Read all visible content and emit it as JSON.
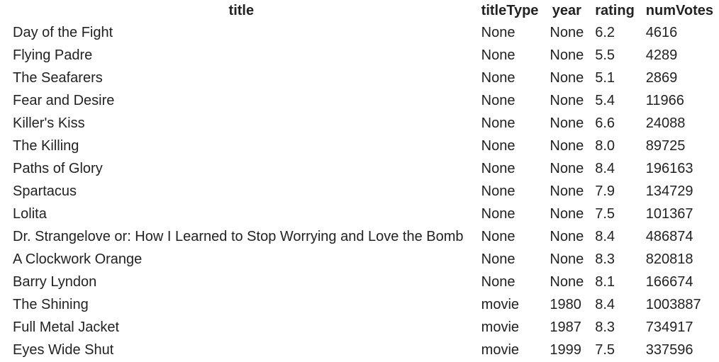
{
  "columns": {
    "title": "title",
    "titleType": "titleType",
    "year": "year",
    "rating": "rating",
    "numVotes": "numVotes"
  },
  "rows": [
    {
      "title": "Day of the Fight",
      "titleType": "None",
      "year": "None",
      "rating": "6.2",
      "numVotes": "4616"
    },
    {
      "title": "Flying Padre",
      "titleType": "None",
      "year": "None",
      "rating": "5.5",
      "numVotes": "4289"
    },
    {
      "title": "The Seafarers",
      "titleType": "None",
      "year": "None",
      "rating": "5.1",
      "numVotes": "2869"
    },
    {
      "title": "Fear and Desire",
      "titleType": "None",
      "year": "None",
      "rating": "5.4",
      "numVotes": "11966"
    },
    {
      "title": "Killer's Kiss",
      "titleType": "None",
      "year": "None",
      "rating": "6.6",
      "numVotes": "24088"
    },
    {
      "title": "The Killing",
      "titleType": "None",
      "year": "None",
      "rating": "8.0",
      "numVotes": "89725"
    },
    {
      "title": "Paths of Glory",
      "titleType": "None",
      "year": "None",
      "rating": "8.4",
      "numVotes": "196163"
    },
    {
      "title": "Spartacus",
      "titleType": "None",
      "year": "None",
      "rating": "7.9",
      "numVotes": "134729"
    },
    {
      "title": "Lolita",
      "titleType": "None",
      "year": "None",
      "rating": "7.5",
      "numVotes": "101367"
    },
    {
      "title": "Dr. Strangelove or: How I Learned to Stop Worrying and Love the Bomb",
      "titleType": "None",
      "year": "None",
      "rating": "8.4",
      "numVotes": "486874"
    },
    {
      "title": "A Clockwork Orange",
      "titleType": "None",
      "year": "None",
      "rating": "8.3",
      "numVotes": "820818"
    },
    {
      "title": "Barry Lyndon",
      "titleType": "None",
      "year": "None",
      "rating": "8.1",
      "numVotes": "166674"
    },
    {
      "title": "The Shining",
      "titleType": "movie",
      "year": "1980",
      "rating": "8.4",
      "numVotes": "1003887"
    },
    {
      "title": "Full Metal Jacket",
      "titleType": "movie",
      "year": "1987",
      "rating": "8.3",
      "numVotes": "734917"
    },
    {
      "title": "Eyes Wide Shut",
      "titleType": "movie",
      "year": "1999",
      "rating": "7.5",
      "numVotes": "337596"
    }
  ]
}
